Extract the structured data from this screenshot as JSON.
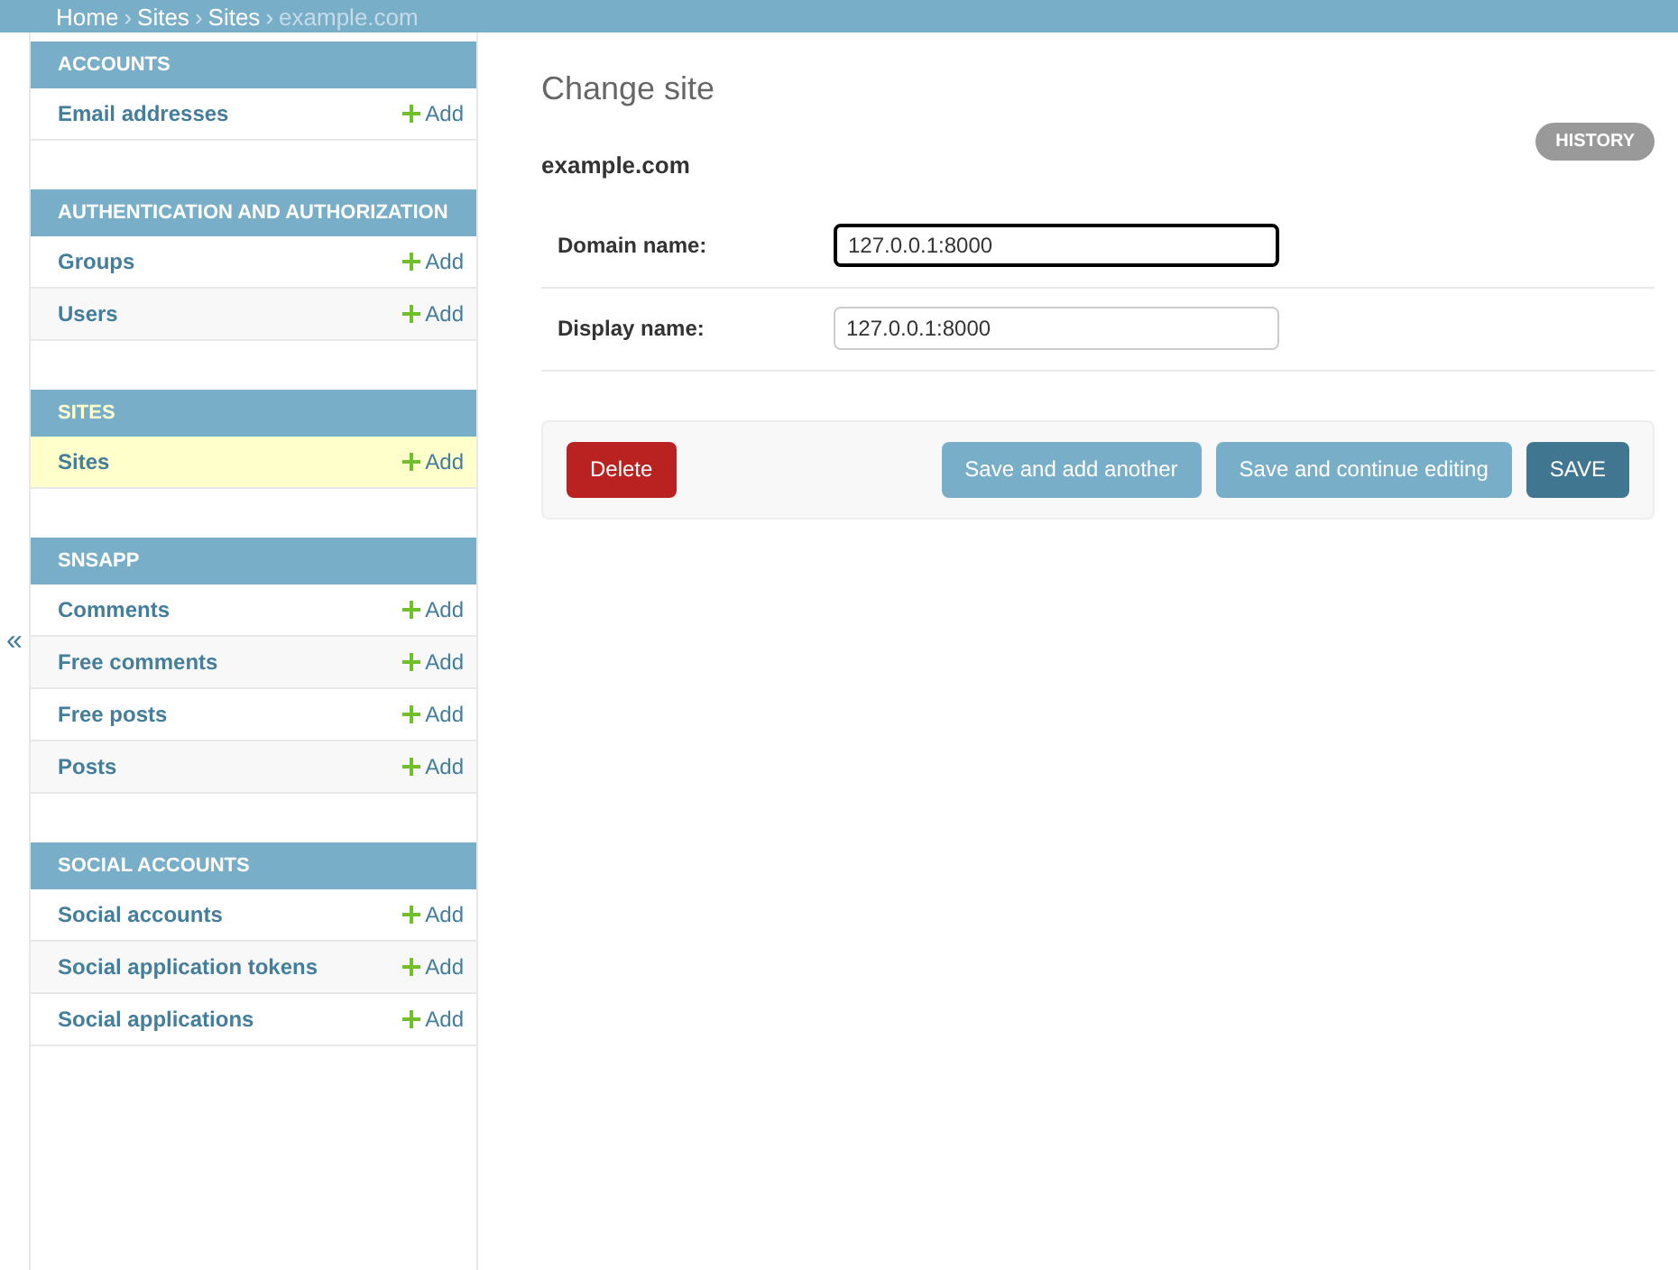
{
  "breadcrumbs": [
    {
      "label": "Home",
      "link": true
    },
    {
      "label": "Sites",
      "link": true
    },
    {
      "label": "Sites",
      "link": true
    },
    {
      "label": "example.com",
      "link": false
    }
  ],
  "breadcrumb_separator": "›",
  "sidebar_toggle": "«",
  "modules": [
    {
      "caption": "ACCOUNTS",
      "selected": false,
      "items": [
        {
          "label": "Email addresses",
          "add": "Add",
          "selected": false
        }
      ]
    },
    {
      "caption": "AUTHENTICATION AND AUTHORIZATION",
      "selected": false,
      "items": [
        {
          "label": "Groups",
          "add": "Add",
          "selected": false
        },
        {
          "label": "Users",
          "add": "Add",
          "selected": false
        }
      ]
    },
    {
      "caption": "SITES",
      "selected": true,
      "items": [
        {
          "label": "Sites",
          "add": "Add",
          "selected": true
        }
      ]
    },
    {
      "caption": "SNSAPP",
      "selected": false,
      "items": [
        {
          "label": "Comments",
          "add": "Add",
          "selected": false
        },
        {
          "label": "Free comments",
          "add": "Add",
          "selected": false
        },
        {
          "label": "Free posts",
          "add": "Add",
          "selected": false
        },
        {
          "label": "Posts",
          "add": "Add",
          "selected": false
        }
      ]
    },
    {
      "caption": "SOCIAL ACCOUNTS",
      "selected": false,
      "items": [
        {
          "label": "Social accounts",
          "add": "Add",
          "selected": false
        },
        {
          "label": "Social application tokens",
          "add": "Add",
          "selected": false
        },
        {
          "label": "Social applications",
          "add": "Add",
          "selected": false
        }
      ]
    }
  ],
  "title": "Change site",
  "history_button": "HISTORY",
  "object_name": "example.com",
  "fields": [
    {
      "label": "Domain name:",
      "value": "127.0.0.1:8000",
      "focused": true
    },
    {
      "label": "Display name:",
      "value": "127.0.0.1:8000",
      "focused": false
    }
  ],
  "submit_row": {
    "delete": "Delete",
    "buttons": [
      {
        "label": "Save and add another",
        "kind": "secondary"
      },
      {
        "label": "Save and continue editing",
        "kind": "secondary"
      },
      {
        "label": "SAVE",
        "kind": "primary"
      }
    ]
  }
}
